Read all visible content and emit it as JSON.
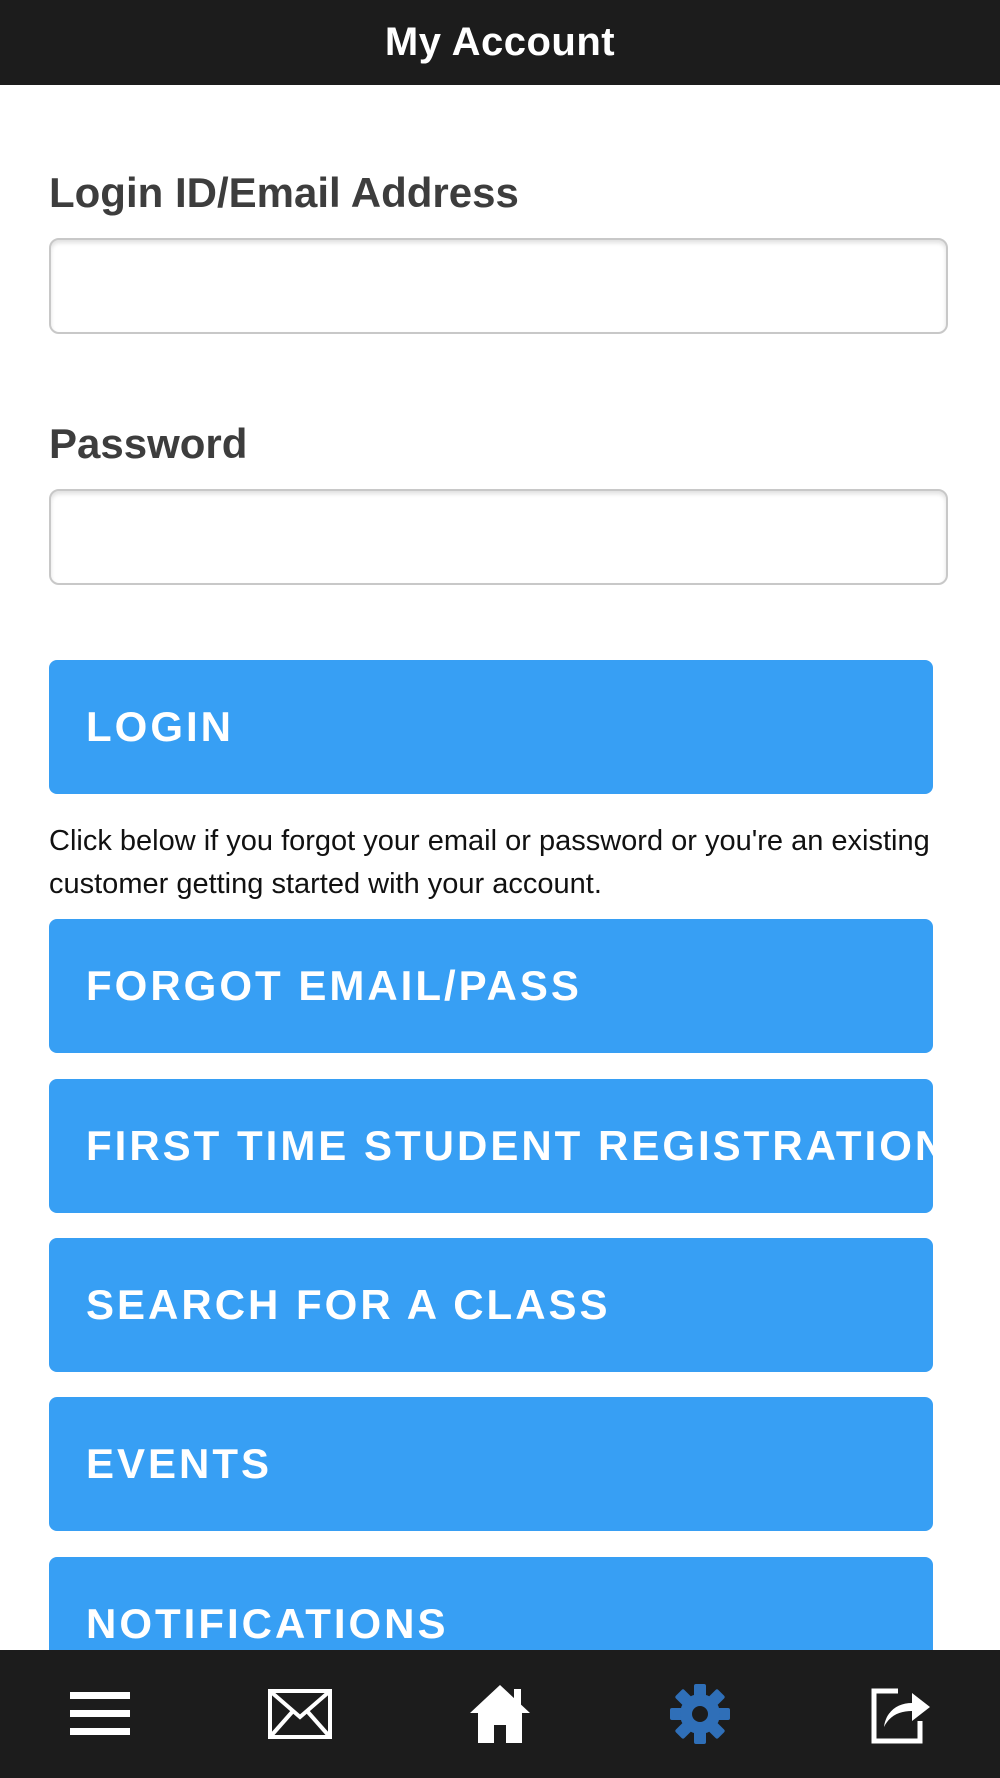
{
  "header": {
    "title": "My Account"
  },
  "form": {
    "login_label": "Login ID/Email Address",
    "login_value": "",
    "password_label": "Password",
    "password_value": ""
  },
  "buttons": {
    "login": "LOGIN",
    "forgot": "FORGOT EMAIL/PASS",
    "first_time": "FIRST TIME STUDENT REGISTRATION",
    "search_class": "SEARCH FOR A CLASS",
    "events": "EVENTS",
    "notifications": "NOTIFICATIONS"
  },
  "help_text": "Click below if you forgot your email or password or you're an existing customer getting started with your account.",
  "bottom_nav": {
    "items": [
      {
        "icon": "menu-icon",
        "active": false
      },
      {
        "icon": "mail-icon",
        "active": false
      },
      {
        "icon": "home-icon",
        "active": false
      },
      {
        "icon": "gear-icon",
        "active": true
      },
      {
        "icon": "share-icon",
        "active": false
      }
    ]
  },
  "colors": {
    "button_blue": "#379ff4",
    "bar_dark": "#1c1c1c",
    "active_icon": "#2f6fb8",
    "inactive_icon": "#ffffff"
  }
}
